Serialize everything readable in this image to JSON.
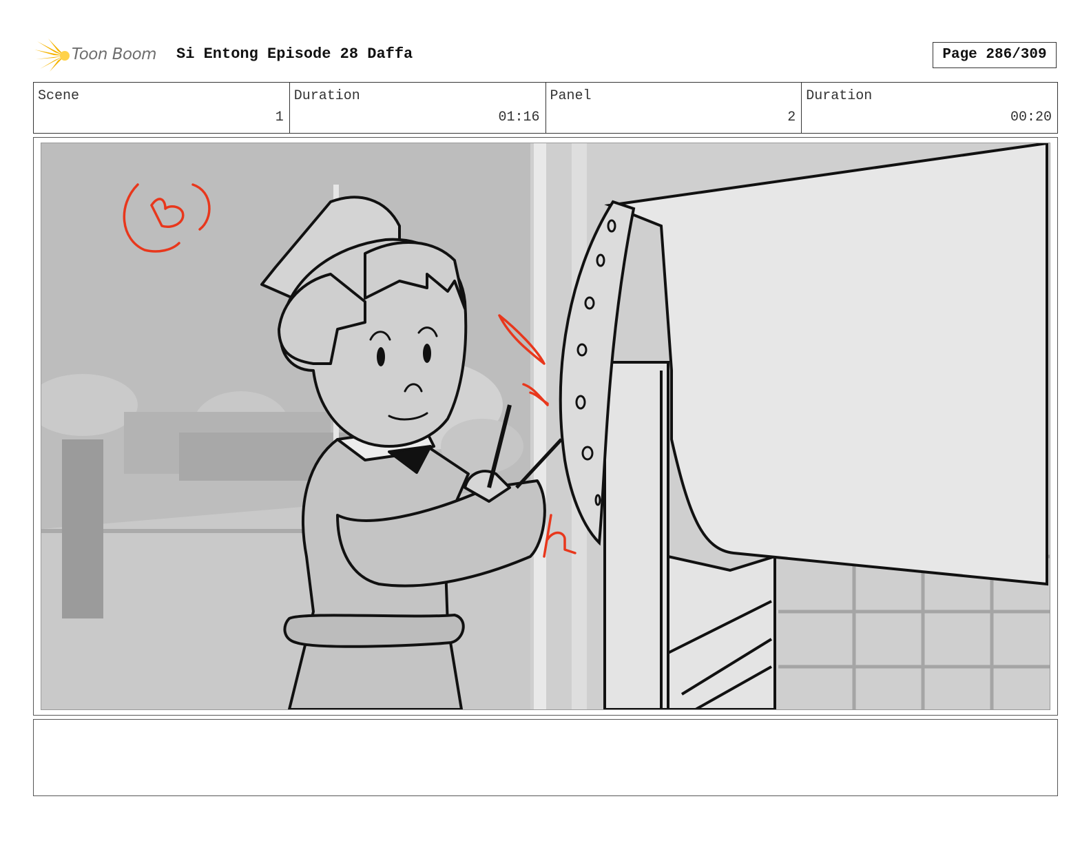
{
  "header": {
    "brand": "Toon Boom",
    "project_title": "Si Entong Episode 28 Daffa",
    "page_indicator": "Page 286/309",
    "brand_color": "#f5b400"
  },
  "info": {
    "scene_label": "Scene",
    "scene_value": "1",
    "scene_duration_label": "Duration",
    "scene_duration_value": "01:16",
    "panel_label": "Panel",
    "panel_value": "2",
    "panel_duration_label": "Duration",
    "panel_duration_value": "00:20"
  },
  "panel": {
    "annotation_color": "#e8371c",
    "drawing_subject": "boy in cap striking a large drum with a stick"
  },
  "notes": {
    "text": ""
  }
}
